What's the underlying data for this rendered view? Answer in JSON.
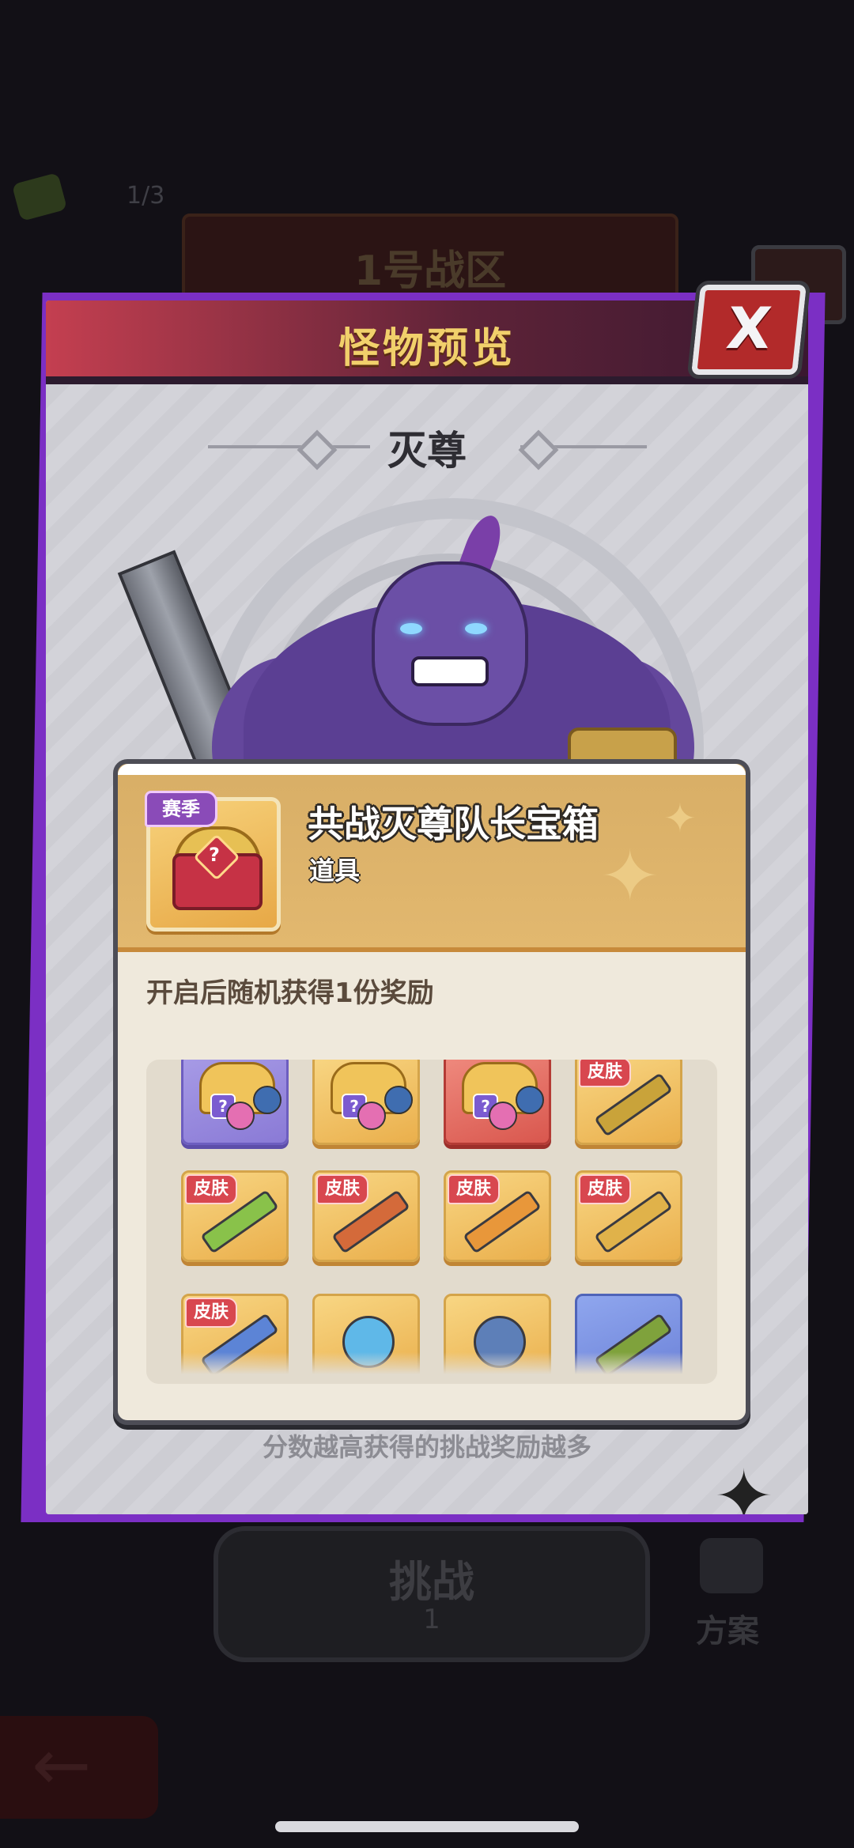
{
  "background": {
    "stage_count": "1/3",
    "zone_title": "1号战区",
    "help_symbol": "?",
    "challenge_button": {
      "label": "挑战",
      "cost": "1"
    },
    "plan_button": {
      "label": "方案"
    }
  },
  "panel": {
    "title": "怪物预览",
    "monster_name": "灭尊",
    "score_hint": "分数越高获得的挑战奖励越多",
    "close_label": "X"
  },
  "item_card": {
    "badge": "赛季",
    "name": "共战灭尊队长宝箱",
    "type": "道具",
    "description": "开启后随机获得1份奖励",
    "chest_question": "?",
    "rewards": [
      {
        "kind": "chest",
        "rarity": "purple",
        "tag": ""
      },
      {
        "kind": "chest",
        "rarity": "gold",
        "tag": ""
      },
      {
        "kind": "chest",
        "rarity": "red",
        "tag": ""
      },
      {
        "kind": "weapon-skin",
        "rarity": "gold",
        "tag": "皮肤"
      },
      {
        "kind": "weapon-skin",
        "rarity": "gold",
        "tag": "皮肤"
      },
      {
        "kind": "weapon-skin",
        "rarity": "gold",
        "tag": "皮肤"
      },
      {
        "kind": "weapon-skin",
        "rarity": "gold",
        "tag": "皮肤"
      },
      {
        "kind": "weapon-skin",
        "rarity": "gold",
        "tag": "皮肤"
      },
      {
        "kind": "weapon-skin",
        "rarity": "gold",
        "tag": "皮肤"
      },
      {
        "kind": "material",
        "rarity": "gold",
        "tag": ""
      },
      {
        "kind": "material",
        "rarity": "gold",
        "tag": ""
      },
      {
        "kind": "weapon",
        "rarity": "blue",
        "tag": ""
      }
    ]
  }
}
